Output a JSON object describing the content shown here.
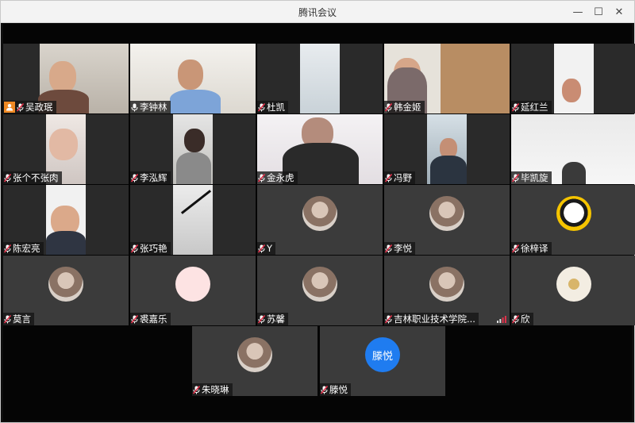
{
  "window": {
    "title": "腾讯会议",
    "minimize_glyph": "—",
    "maximize_glyph": "☐",
    "close_glyph": "✕"
  },
  "colors": {
    "stage_bg": "#050505",
    "tile_bg": "#3b3b3b",
    "active_outline": "#3fbf3f",
    "mic_muted": "#e2324b",
    "host_badge": "#f08a24",
    "avatar_blue": "#1f7cf0"
  },
  "participants": [
    {
      "name": "吴政珉",
      "mic": "muted",
      "video": true,
      "host": true
    },
    {
      "name": "李钟林",
      "mic": "on",
      "video": true,
      "active_speaker": true
    },
    {
      "name": "杜凯",
      "mic": "muted",
      "video": true
    },
    {
      "name": "韩金姬",
      "mic": "muted",
      "video": true
    },
    {
      "name": "延红兰",
      "mic": "muted",
      "video": true
    },
    {
      "name": "张个不张肉",
      "mic": "muted",
      "video": true
    },
    {
      "name": "李泓辉",
      "mic": "muted",
      "video": true
    },
    {
      "name": "金永虎",
      "mic": "muted",
      "video": true
    },
    {
      "name": "冯野",
      "mic": "muted",
      "video": true
    },
    {
      "name": "毕凯旋",
      "mic": "muted",
      "video": true
    },
    {
      "name": "陈宏亮",
      "mic": "muted",
      "video": true
    },
    {
      "name": "张巧艳",
      "mic": "muted",
      "video": true
    },
    {
      "name": "Y",
      "mic": "muted",
      "video": false,
      "avatar": "photo"
    },
    {
      "name": "李悦",
      "mic": "muted",
      "video": false,
      "avatar": "photo"
    },
    {
      "name": "徐梓译",
      "mic": "muted",
      "video": false,
      "avatar": "cartoon"
    },
    {
      "name": "莫言",
      "mic": "muted",
      "video": false,
      "avatar": "photo"
    },
    {
      "name": "裘嘉乐",
      "mic": "muted",
      "video": false,
      "avatar": "pink"
    },
    {
      "name": "苏馨",
      "mic": "muted",
      "video": false,
      "avatar": "photo"
    },
    {
      "name": "吉林职业技术学院...",
      "mic": "muted",
      "video": false,
      "avatar": "photo",
      "signal": true
    },
    {
      "name": "欣",
      "mic": "muted",
      "video": false,
      "avatar": "flower"
    },
    {
      "name": "朱晓琳",
      "mic": "muted",
      "video": false,
      "avatar": "photo"
    },
    {
      "name": "滕悦",
      "mic": "muted",
      "video": false,
      "avatar": "text",
      "avatar_text": "滕悦"
    }
  ]
}
